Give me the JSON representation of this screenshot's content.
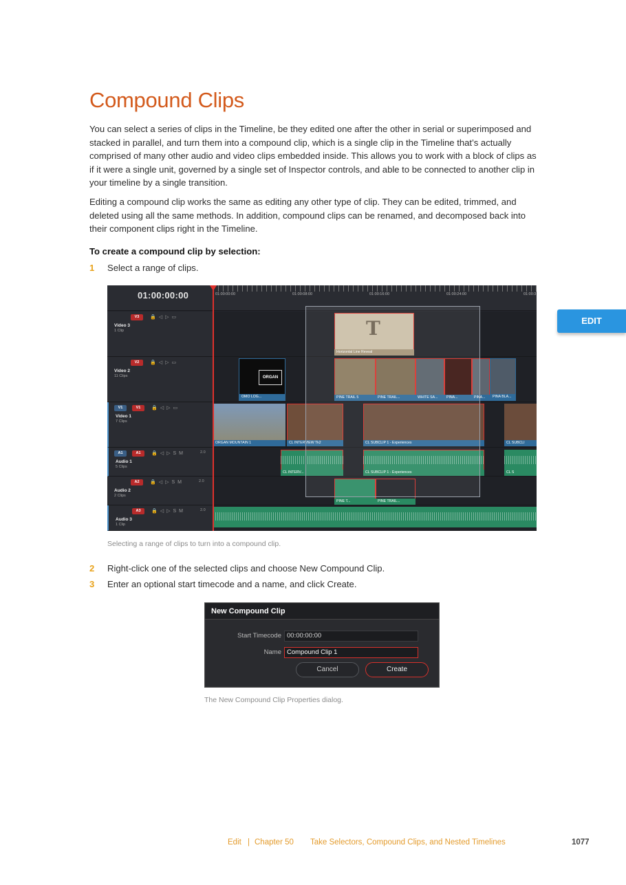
{
  "title": "Compound Clips",
  "paragraphs": [
    "You can select a series of clips in the Timeline, be they edited one after the other in serial or superimposed and stacked in parallel, and turn them into a compound clip, which is a single clip in the Timeline that’s actually comprised of many other audio and video clips embedded inside. This allows you to work with a block of clips as if it were a single unit, governed by a single set of Inspector controls, and able to be connected to another clip in your timeline by a single transition.",
    "Editing a compound clip works the same as editing any other type of clip. They can be edited, trimmed, and deleted using all the same methods. In addition, compound clips can be renamed, and decomposed back into their component clips right in the Timeline."
  ],
  "subheading": "To create a compound clip by selection:",
  "steps": [
    {
      "num": "1",
      "text": "Select a range of clips."
    },
    {
      "num": "2",
      "text": "Right-click one of the selected clips and choose New Compound Clip."
    },
    {
      "num": "3",
      "text": "Enter an optional start timecode and a name, and click Create."
    }
  ],
  "captions": {
    "timeline": "Selecting a range of clips to turn into a compound clip.",
    "dialog": "The New Compound Clip Properties dialog."
  },
  "side_tab": "EDIT",
  "timeline": {
    "timecode": "01:00:00:00",
    "ruler": [
      "01:00:00:00",
      "01:00:08:00",
      "01:00:16:00",
      "01:00:24:00",
      "01:00:3"
    ],
    "tracks": {
      "v3": {
        "badge": "V3",
        "name": "Video 3",
        "clips": "1 Clip"
      },
      "v2": {
        "badge": "V2",
        "name": "Video 2",
        "clips": "11 Clips"
      },
      "v1": {
        "badge": "V1",
        "badge2": "V1",
        "name": "Video 1",
        "clips": "7 Clips"
      },
      "a1": {
        "badge": "A1",
        "badge2": "A1",
        "name": "Audio 1",
        "clips": "5 Clips",
        "level": "2.0"
      },
      "a2": {
        "badge": "A2",
        "name": "Audio 2",
        "clips": "2 Clips",
        "level": "2.0"
      },
      "a3": {
        "badge": "A3",
        "name": "Audio 3",
        "clips": "1 Clip",
        "level": "2.0"
      }
    },
    "clip_labels": {
      "title_clip": "Horizontal Line Reveal",
      "title_glyph": "T",
      "logo": "OMO LOG...",
      "logo_text": "ORGAN",
      "pine5": "PINE TRAIL 5",
      "pine_trail": "PINE TRAIL...",
      "white": "WHITE SA...",
      "pina1": "PINA...",
      "pina2": "PINA...",
      "pina_bla": "PINA BLA...",
      "organ_mtn": "ORGAN MOUNTAIN 1",
      "interview": "CL INTERVIEW Tk2",
      "subclip": "CL SUBCLIP 1 - Experiences",
      "subclip_cut": "CL SUBCLI",
      "a_interv": "CL INTERV...",
      "a_subclip": "CL SUBCLIP 1 - Experiences",
      "a_cl": "CL S",
      "a2_pine": "PINE T...",
      "a2_pine_trail": "PINE TRAIL..."
    }
  },
  "dialog": {
    "title": "New Compound Clip",
    "start_label": "Start Timecode",
    "start_value": "00:00:00:00",
    "name_label": "Name",
    "name_value": "Compound Clip 1",
    "cancel": "Cancel",
    "create": "Create"
  },
  "footer": {
    "section": "Edit",
    "sep": "|",
    "chapter": "Chapter 50",
    "chapter_title": "Take Selectors, Compound Clips, and Nested Timelines",
    "page": "1077"
  },
  "colors": {
    "heading": "#d35a1c",
    "step_number": "#e8a21a",
    "edit_tab": "#2a95e0",
    "selection": "#d8312c"
  }
}
